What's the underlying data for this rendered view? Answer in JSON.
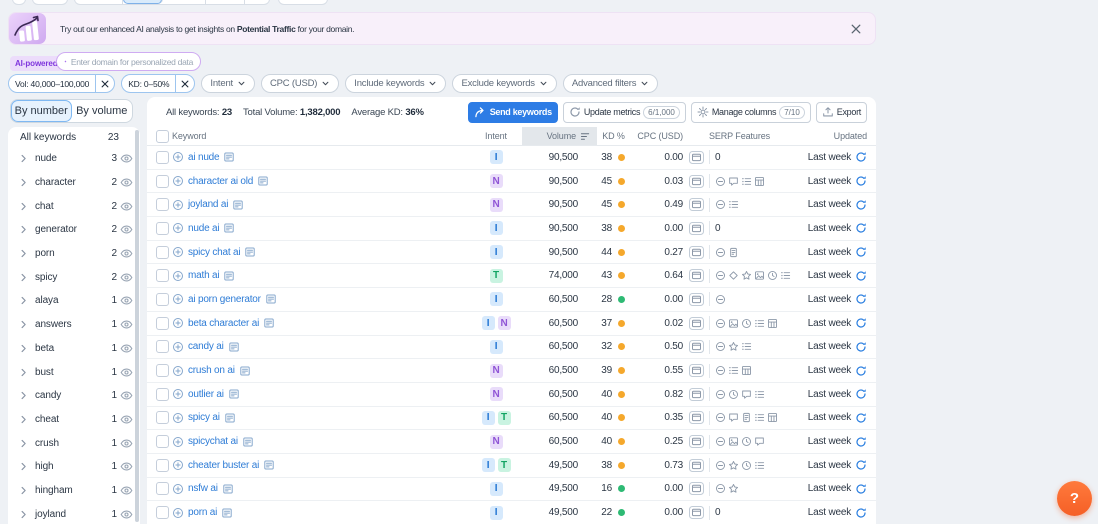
{
  "banner": {
    "text_before": "Try out our enhanced AI analysis to get insights on ",
    "highlight": "Potential Traffic",
    "text_after": " for your domain."
  },
  "ai_bar": {
    "badge": "AI-powered",
    "input_placeholder": "Enter domain for personalized data"
  },
  "filters": {
    "chips": [
      {
        "label": "Vol: 40,000–100,000"
      },
      {
        "label": "KD: 0–50%"
      }
    ],
    "dropdowns": [
      "Intent",
      "CPC (USD)",
      "Include keywords",
      "Exclude keywords",
      "Advanced filters"
    ]
  },
  "sidebar": {
    "toggle": {
      "by_number": "By number",
      "by_volume": "By volume",
      "active": "By number"
    },
    "all_label": "All keywords",
    "all_count": "23",
    "groups": [
      {
        "label": "nude",
        "count": "3"
      },
      {
        "label": "character",
        "count": "2"
      },
      {
        "label": "chat",
        "count": "2"
      },
      {
        "label": "generator",
        "count": "2"
      },
      {
        "label": "porn",
        "count": "2"
      },
      {
        "label": "spicy",
        "count": "2"
      },
      {
        "label": "alaya",
        "count": "1"
      },
      {
        "label": "answers",
        "count": "1"
      },
      {
        "label": "beta",
        "count": "1"
      },
      {
        "label": "bust",
        "count": "1"
      },
      {
        "label": "candy",
        "count": "1"
      },
      {
        "label": "cheat",
        "count": "1"
      },
      {
        "label": "crush",
        "count": "1"
      },
      {
        "label": "high",
        "count": "1"
      },
      {
        "label": "hingham",
        "count": "1"
      },
      {
        "label": "joyland",
        "count": "1"
      }
    ]
  },
  "summary": {
    "all_keywords_label": "All keywords:",
    "all_keywords_value": "23",
    "total_volume_label": "Total Volume:",
    "total_volume_value": "1,382,000",
    "avg_kd_label": "Average KD:",
    "avg_kd_value": "36%"
  },
  "actions": {
    "send": "Send keywords",
    "update": "Update metrics",
    "update_badge": "6/1,000",
    "manage": "Manage columns",
    "manage_badge": "7/10",
    "export": "Export"
  },
  "table": {
    "headers": {
      "keyword": "Keyword",
      "intent": "Intent",
      "volume": "Volume",
      "kd": "KD %",
      "cpc": "CPC (USD)",
      "serp": "SERP Features",
      "updated": "Updated"
    },
    "rows": [
      {
        "keyword": "ai nude",
        "intents": [
          "I"
        ],
        "volume": "90,500",
        "kd": 38,
        "cpc": "0.00",
        "serp_features": [],
        "serp_count": "0",
        "updated": "Last week"
      },
      {
        "keyword": "character ai old",
        "intents": [
          "N"
        ],
        "volume": "90,500",
        "kd": 45,
        "cpc": "0.03",
        "serp_features": [
          "link",
          "chat",
          "list",
          "table"
        ],
        "serp_count": null,
        "updated": "Last week"
      },
      {
        "keyword": "joyland ai",
        "intents": [
          "N"
        ],
        "volume": "90,500",
        "kd": 45,
        "cpc": "0.49",
        "serp_features": [
          "link",
          "list"
        ],
        "serp_count": null,
        "updated": "Last week"
      },
      {
        "keyword": "nude ai",
        "intents": [
          "I"
        ],
        "volume": "90,500",
        "kd": 38,
        "cpc": "0.00",
        "serp_features": [],
        "serp_count": "0",
        "updated": "Last week"
      },
      {
        "keyword": "spicy chat ai",
        "intents": [
          "I"
        ],
        "volume": "90,500",
        "kd": 44,
        "cpc": "0.27",
        "serp_features": [
          "link",
          "page"
        ],
        "serp_count": null,
        "updated": "Last week"
      },
      {
        "keyword": "math ai",
        "intents": [
          "T"
        ],
        "volume": "74,000",
        "kd": 43,
        "cpc": "0.64",
        "serp_features": [
          "link",
          "diamond",
          "star",
          "image",
          "clock",
          "list"
        ],
        "serp_count": null,
        "updated": "Last week"
      },
      {
        "keyword": "ai porn generator",
        "intents": [
          "I"
        ],
        "volume": "60,500",
        "kd": 28,
        "cpc": "0.00",
        "serp_features": [
          "link"
        ],
        "serp_count": null,
        "updated": "Last week"
      },
      {
        "keyword": "beta character ai",
        "intents": [
          "I",
          "N"
        ],
        "volume": "60,500",
        "kd": 37,
        "cpc": "0.02",
        "serp_features": [
          "link",
          "image",
          "clock",
          "list",
          "table"
        ],
        "serp_count": null,
        "updated": "Last week"
      },
      {
        "keyword": "candy ai",
        "intents": [
          "I"
        ],
        "volume": "60,500",
        "kd": 32,
        "cpc": "0.50",
        "serp_features": [
          "link",
          "star",
          "list"
        ],
        "serp_count": null,
        "updated": "Last week"
      },
      {
        "keyword": "crush on ai",
        "intents": [
          "N"
        ],
        "volume": "60,500",
        "kd": 39,
        "cpc": "0.55",
        "serp_features": [
          "link",
          "list",
          "table"
        ],
        "serp_count": null,
        "updated": "Last week"
      },
      {
        "keyword": "outlier ai",
        "intents": [
          "N"
        ],
        "volume": "60,500",
        "kd": 40,
        "cpc": "0.82",
        "serp_features": [
          "link",
          "clock",
          "chat",
          "list"
        ],
        "serp_count": null,
        "updated": "Last week"
      },
      {
        "keyword": "spicy ai",
        "intents": [
          "I",
          "T"
        ],
        "volume": "60,500",
        "kd": 40,
        "cpc": "0.35",
        "serp_features": [
          "link",
          "chat",
          "page",
          "list",
          "table"
        ],
        "serp_count": null,
        "updated": "Last week"
      },
      {
        "keyword": "spicychat ai",
        "intents": [
          "N"
        ],
        "volume": "60,500",
        "kd": 40,
        "cpc": "0.25",
        "serp_features": [
          "link",
          "image",
          "clock",
          "chat"
        ],
        "serp_count": null,
        "updated": "Last week"
      },
      {
        "keyword": "cheater buster ai",
        "intents": [
          "I",
          "T"
        ],
        "volume": "49,500",
        "kd": 38,
        "cpc": "0.73",
        "serp_features": [
          "link",
          "star",
          "clock",
          "list"
        ],
        "serp_count": null,
        "updated": "Last week"
      },
      {
        "keyword": "nsfw ai",
        "intents": [
          "I"
        ],
        "volume": "49,500",
        "kd": 16,
        "cpc": "0.00",
        "serp_features": [
          "link",
          "star"
        ],
        "serp_count": null,
        "updated": "Last week"
      },
      {
        "keyword": "porn ai",
        "intents": [
          "I"
        ],
        "volume": "49,500",
        "kd": 22,
        "cpc": "0.00",
        "serp_features": [],
        "serp_count": "0",
        "updated": "Last week"
      }
    ]
  },
  "help": {
    "label": "?"
  }
}
